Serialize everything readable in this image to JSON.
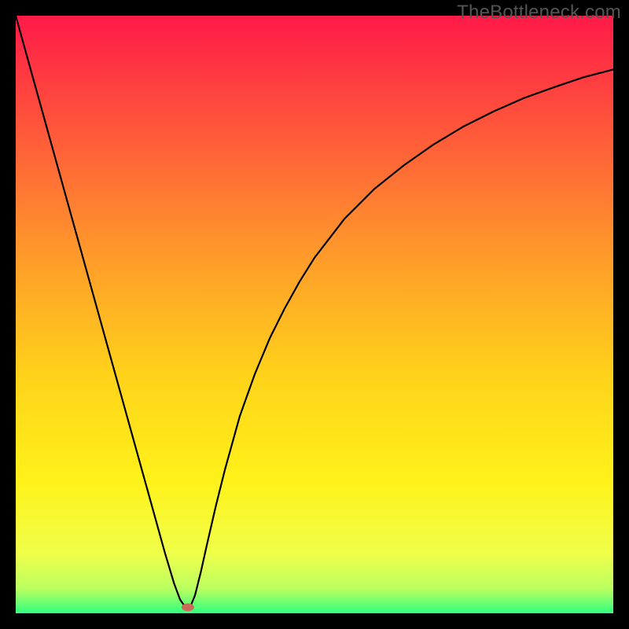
{
  "watermark": "TheBottleneck.com",
  "chart_data": {
    "type": "line",
    "title": "",
    "xlabel": "",
    "ylabel": "",
    "xlim": [
      0,
      100
    ],
    "ylim": [
      0,
      100
    ],
    "series": [
      {
        "name": "curve",
        "x": [
          0,
          2.5,
          5,
          7.5,
          10,
          12.5,
          15,
          17.5,
          20,
          22.5,
          25,
          26.5,
          27.5,
          28.2,
          28.8,
          29.3,
          30,
          31,
          32,
          33.5,
          35,
          37.5,
          40,
          42.5,
          45,
          47.5,
          50,
          55,
          60,
          65,
          70,
          75,
          80,
          85,
          90,
          95,
          100
        ],
        "y": [
          100,
          91,
          82,
          73,
          64,
          55,
          46,
          37,
          28,
          19,
          10,
          5,
          2.3,
          1.3,
          1.0,
          1.3,
          3,
          7,
          11.5,
          18,
          24,
          33,
          40,
          46,
          51,
          55.5,
          59.5,
          66,
          71,
          75,
          78.5,
          81.5,
          84,
          86.2,
          88,
          89.7,
          91
        ]
      }
    ],
    "marker": {
      "x": 28.8,
      "y": 1.0
    },
    "gradient_stops": [
      {
        "offset": 0.0,
        "color": "#ff1a48"
      },
      {
        "offset": 0.2,
        "color": "#ff5a3a"
      },
      {
        "offset": 0.4,
        "color": "#ff9a2a"
      },
      {
        "offset": 0.6,
        "color": "#ffd21a"
      },
      {
        "offset": 0.78,
        "color": "#fff21a"
      },
      {
        "offset": 0.9,
        "color": "#f0ff4a"
      },
      {
        "offset": 0.96,
        "color": "#b8ff60"
      },
      {
        "offset": 1.0,
        "color": "#30ff80"
      }
    ]
  }
}
